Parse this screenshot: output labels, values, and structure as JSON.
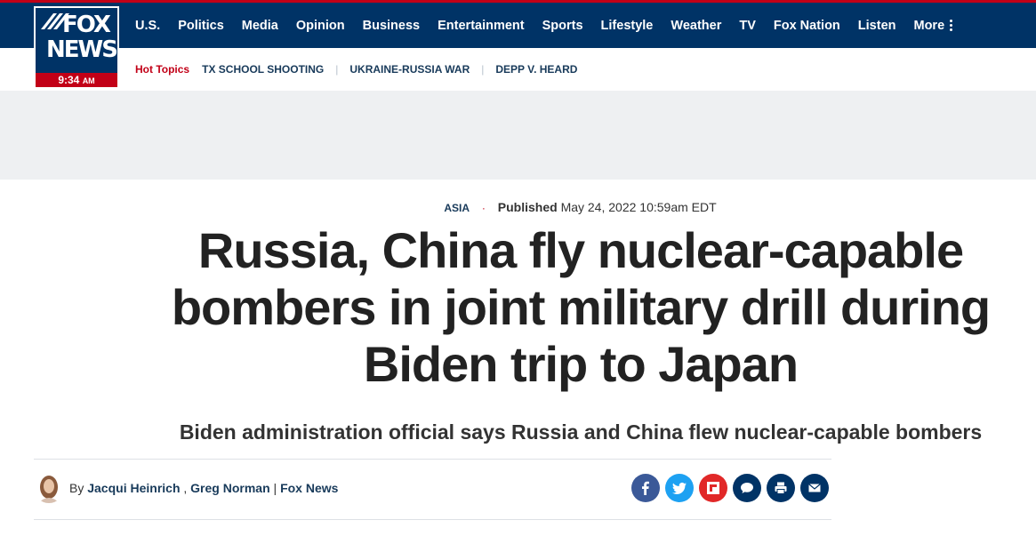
{
  "brand": {
    "logo_line1": "FOX",
    "logo_line2": "NEWS",
    "time": "9:34",
    "ampm": "AM",
    "navy": "#003366",
    "red": "#c20017"
  },
  "nav": {
    "items": [
      "U.S.",
      "Politics",
      "Media",
      "Opinion",
      "Business",
      "Entertainment",
      "Sports",
      "Lifestyle",
      "Weather",
      "TV",
      "Fox Nation",
      "Listen"
    ],
    "more_label": "More"
  },
  "hot_topics": {
    "label": "Hot Topics",
    "items": [
      "TX SCHOOL SHOOTING",
      "UKRAINE-RUSSIA WAR",
      "DEPP V. HEARD"
    ]
  },
  "article": {
    "eyebrow": "ASIA",
    "published_label": "Published",
    "published_date": "May 24, 2022 10:59am EDT",
    "headline": "Russia, China fly nuclear-capable bombers in joint military drill during Biden trip to Japan",
    "subhead": "Biden administration official says Russia and China flew nuclear-capable bombers",
    "byline_prefix": "By",
    "authors": [
      "Jacqui Heinrich",
      "Greg Norman"
    ],
    "outlet": "Fox News"
  },
  "share": [
    {
      "name": "facebook",
      "color": "#3b5998",
      "icon": "facebook-icon"
    },
    {
      "name": "twitter",
      "color": "#1da1f2",
      "icon": "twitter-icon"
    },
    {
      "name": "flipboard",
      "color": "#e12828",
      "icon": "flipboard-icon"
    },
    {
      "name": "comments",
      "color": "#003366",
      "icon": "comment-icon"
    },
    {
      "name": "print",
      "color": "#003366",
      "icon": "print-icon"
    },
    {
      "name": "email",
      "color": "#003366",
      "icon": "email-icon"
    }
  ]
}
